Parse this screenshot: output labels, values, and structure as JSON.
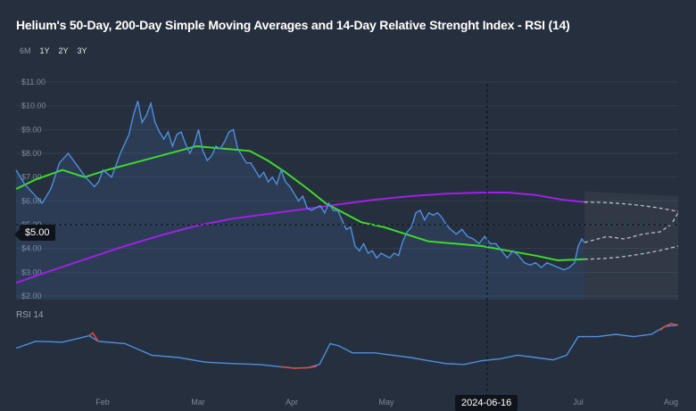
{
  "title": "Helium's 50-Day, 200-Day Simple Moving Averages and 14-Day Relative Strenght Index - RSI (14)",
  "range_buttons": [
    {
      "label": "6M",
      "active": false
    },
    {
      "label": "1Y",
      "active": true
    },
    {
      "label": "2Y",
      "active": true
    },
    {
      "label": "3Y",
      "active": true
    }
  ],
  "crosshair": {
    "price_label": "$5.00",
    "date_label": "2024-06-16"
  },
  "colors": {
    "price": "#4f8fe0",
    "sma50": "#3ddc2a",
    "sma200": "#a020e6",
    "rsi": "#4f8fe0",
    "rsi_extreme": "#e04848",
    "forecast": "#b8bec8",
    "background": "#262f3d"
  },
  "chart_data": [
    {
      "type": "line",
      "name": "price_panel",
      "y_tick_labels": [
        "$11.00",
        "$10.00",
        "$9.00",
        "$8.00",
        "$7.00",
        "$6.00",
        "$5.00",
        "$4.00",
        "$3.00",
        "$2.00"
      ],
      "ylim": [
        2,
        11
      ],
      "x_tick_labels": [
        "Feb",
        "Mar",
        "Apr",
        "May",
        "Jun",
        "Jul",
        "Aug"
      ],
      "series": [
        {
          "role": "price",
          "points": [
            [
              0,
              7.3
            ],
            [
              0.02,
              6.7
            ],
            [
              0.04,
              6.3
            ],
            [
              0.06,
              5.9
            ],
            [
              0.08,
              6.5
            ],
            [
              0.1,
              7.6
            ],
            [
              0.12,
              8.0
            ],
            [
              0.14,
              7.5
            ],
            [
              0.16,
              7.0
            ],
            [
              0.18,
              6.6
            ],
            [
              0.19,
              6.8
            ],
            [
              0.2,
              7.3
            ],
            [
              0.22,
              7.0
            ],
            [
              0.24,
              8.0
            ],
            [
              0.26,
              8.8
            ],
            [
              0.27,
              9.6
            ],
            [
              0.28,
              10.2
            ],
            [
              0.29,
              9.3
            ],
            [
              0.3,
              9.6
            ],
            [
              0.31,
              10.1
            ],
            [
              0.32,
              9.3
            ],
            [
              0.33,
              8.9
            ],
            [
              0.34,
              8.6
            ],
            [
              0.35,
              8.9
            ],
            [
              0.36,
              8.3
            ],
            [
              0.37,
              8.8
            ],
            [
              0.38,
              8.9
            ],
            [
              0.39,
              8.4
            ],
            [
              0.4,
              8.0
            ],
            [
              0.41,
              8.4
            ],
            [
              0.42,
              9.0
            ],
            [
              0.43,
              8.1
            ],
            [
              0.44,
              7.7
            ],
            [
              0.45,
              7.9
            ],
            [
              0.46,
              8.3
            ],
            [
              0.47,
              8.2
            ],
            [
              0.48,
              8.5
            ],
            [
              0.49,
              8.9
            ],
            [
              0.5,
              9.0
            ],
            [
              0.51,
              8.2
            ],
            [
              0.52,
              7.9
            ],
            [
              0.53,
              7.6
            ],
            [
              0.54,
              7.6
            ],
            [
              0.55,
              7.3
            ],
            [
              0.56,
              7.0
            ],
            [
              0.57,
              7.2
            ],
            [
              0.58,
              6.8
            ],
            [
              0.59,
              7.0
            ],
            [
              0.6,
              6.7
            ],
            [
              0.61,
              7.3
            ],
            [
              0.62,
              6.8
            ],
            [
              0.63,
              6.6
            ],
            [
              0.64,
              6.3
            ],
            [
              0.65,
              6.0
            ],
            [
              0.66,
              6.2
            ],
            [
              0.67,
              5.7
            ],
            [
              0.68,
              5.6
            ],
            [
              0.69,
              5.7
            ],
            [
              0.7,
              5.8
            ],
            [
              0.71,
              5.5
            ],
            [
              0.72,
              5.9
            ],
            [
              0.73,
              5.6
            ],
            [
              0.74,
              5.6
            ],
            [
              0.75,
              5.2
            ],
            [
              0.76,
              4.8
            ],
            [
              0.77,
              4.9
            ],
            [
              0.78,
              4.1
            ],
            [
              0.79,
              3.9
            ],
            [
              0.8,
              4.2
            ],
            [
              0.81,
              3.8
            ],
            [
              0.82,
              3.9
            ],
            [
              0.83,
              3.6
            ],
            [
              0.84,
              3.8
            ],
            [
              0.85,
              3.7
            ],
            [
              0.86,
              3.6
            ],
            [
              0.87,
              3.8
            ],
            [
              0.88,
              3.7
            ],
            [
              0.89,
              4.3
            ],
            [
              0.9,
              4.7
            ],
            [
              0.91,
              4.9
            ],
            [
              0.92,
              5.5
            ],
            [
              0.93,
              5.6
            ],
            [
              0.94,
              5.2
            ],
            [
              0.95,
              5.5
            ],
            [
              0.96,
              5.4
            ],
            [
              0.97,
              5.5
            ],
            [
              0.98,
              5.3
            ],
            [
              0.99,
              5.0
            ],
            [
              1.0,
              4.8
            ]
          ]
        },
        {
          "role": "price_tail",
          "points": [
            [
              0,
              4.8
            ],
            [
              0.05,
              4.6
            ],
            [
              0.1,
              4.8
            ],
            [
              0.15,
              4.5
            ],
            [
              0.2,
              4.4
            ],
            [
              0.25,
              4.2
            ],
            [
              0.3,
              4.5
            ],
            [
              0.35,
              4.2
            ],
            [
              0.4,
              4.2
            ],
            [
              0.45,
              3.9
            ],
            [
              0.5,
              3.6
            ],
            [
              0.55,
              3.9
            ],
            [
              0.6,
              3.7
            ],
            [
              0.65,
              3.4
            ],
            [
              0.7,
              3.3
            ],
            [
              0.75,
              3.4
            ],
            [
              0.8,
              3.2
            ],
            [
              0.85,
              3.4
            ],
            [
              0.9,
              3.3
            ],
            [
              0.95,
              3.2
            ],
            [
              1.0,
              3.1
            ]
          ]
        }
      ]
    },
    {
      "type": "line",
      "name": "rsi_panel",
      "label": "RSI 14",
      "ylim": [
        0,
        100
      ]
    }
  ]
}
